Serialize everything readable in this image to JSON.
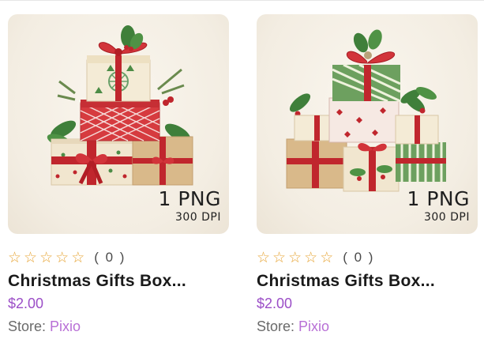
{
  "products": [
    {
      "badge_main": "1 PNG",
      "badge_sub": "300 DPI",
      "rating_stars": 0,
      "rating_count": "( 0 )",
      "title": "Christmas Gifts Box...",
      "price": "$2.00",
      "store_label": "Store:",
      "store_name": "Pixio"
    },
    {
      "badge_main": "1 PNG",
      "badge_sub": "300 DPI",
      "rating_stars": 0,
      "rating_count": "( 0 )",
      "title": "Christmas Gifts Box...",
      "price": "$2.00",
      "store_label": "Store:",
      "store_name": "Pixio"
    }
  ],
  "icons": {
    "star": "star-outline-icon"
  },
  "colors": {
    "price": "#9b4ec7",
    "store_link": "#b86fd6",
    "star": "#e7a536"
  }
}
